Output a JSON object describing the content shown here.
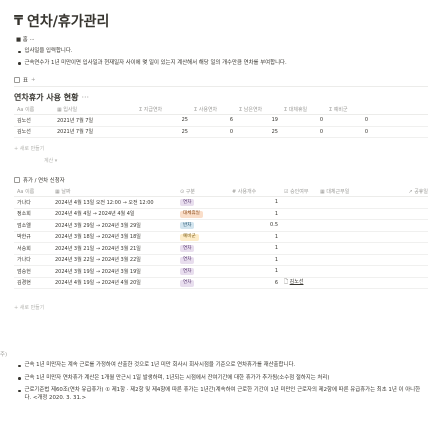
{
  "page": {
    "icon": "₸",
    "title": "연차/휴가관리",
    "toggle_label": "■ 홈 ···",
    "bullets": [
      "입사일을 입력합니다.",
      "근속연수가 1년 미만이면 입사일과 현재일자 사이에 몇 일이 있는지 계산해서 해당 일의 개수만큼 연차를 부여합니다."
    ]
  },
  "table1": {
    "view_label": "표",
    "heading": "연차휴가 사용 현황",
    "columns": [
      "이름",
      "입사일",
      "지급연차",
      "사용연차",
      "남은연차",
      "대체휴일",
      "예비군"
    ],
    "rows": [
      {
        "name": "김노선",
        "date": "2021년 7월 7일",
        "v1": "25",
        "v2": "6",
        "v3": "19",
        "v4": "0",
        "v5": "0"
      },
      {
        "name": "김노선",
        "date": "2021년 7월 7일",
        "v1": "25",
        "v2": "0",
        "v3": "25",
        "v4": "0",
        "v5": "0"
      }
    ],
    "add_label": "+ 새로 만들기",
    "calc_label": "계산 ▾"
  },
  "table2": {
    "view_label": "휴가 / 연차 신청자",
    "columns": [
      "이름",
      "날짜",
      "구분",
      "사용개수",
      "승인여부",
      "대체근무일",
      "공휴일"
    ],
    "rows": [
      {
        "name": "가나다",
        "date": "2024년 4월 13일 오전 12:00 → 오전 12:00",
        "tag": "연차",
        "count": "1",
        "extra": ""
      },
      {
        "name": "정소희",
        "date": "2024년 4월 4일 → 2024년 4월 4일",
        "tag": "대체휴일",
        "count": "1",
        "extra": ""
      },
      {
        "name": "엄소엘",
        "date": "2024년 3월 29일 → 2024년 3월 29일",
        "tag": "반차",
        "count": "0.5",
        "extra": ""
      },
      {
        "name": "박한규",
        "date": "2024년 3월 18일 → 2024년 3월 18일",
        "tag": "예비군",
        "count": "1",
        "extra": ""
      },
      {
        "name": "서승희",
        "date": "2024년 3월 21일 → 2024년 3월 21일",
        "tag": "연차",
        "count": "1",
        "extra": ""
      },
      {
        "name": "가나다",
        "date": "2024년 3월 22일 → 2024년 3월 22일",
        "tag": "연차",
        "count": "1",
        "extra": ""
      },
      {
        "name": "엄승헌",
        "date": "2024년 3월 19일 → 2024년 3월 19일",
        "tag": "연차",
        "count": "1",
        "extra": ""
      },
      {
        "name": "김경현",
        "date": "2024년 4월 19일 → 2024년 4월 20일",
        "tag": "연차",
        "count": "6",
        "extra": "김노선"
      }
    ],
    "add_label": "+ 새로 만들기"
  },
  "tag_colors": {
    "연차": {
      "bg": "#e8deee",
      "fg": "#5a3a72"
    },
    "대체휴일": {
      "bg": "#fadec9",
      "fg": "#8a4a1a"
    },
    "반차": {
      "bg": "#d3e5ef",
      "fg": "#1f4f6b"
    },
    "예비군": {
      "bg": "#fdecc8",
      "fg": "#7a5a12"
    }
  },
  "left_fragment": "주)",
  "notes": [
    "근속 1년 미만자는 계속 근로를 가정하여 산출한 것으로 1년 미만 회사시 회사시점을 기준으로 연차휴가를 재산출합니다.",
    "근속 1년 미만자 연차휴가 계산은 1개월 만근시 1일 발생하며, 1년되는 시점에서 잔여기간에 대한 휴가가 추가됨(소수점 절하지는 처리)",
    "근로기준법 제60조(연차 유급휴가) ① 제1항 · 제2항 및 제4항에 따른 휴가는 1년간(계속하여 근로한 기간이 1년 미만인 근로자의 제2항에 따른 유급휴가는 최초 1년 이 아니한다. <개정 2020. 3. 31.>"
  ]
}
